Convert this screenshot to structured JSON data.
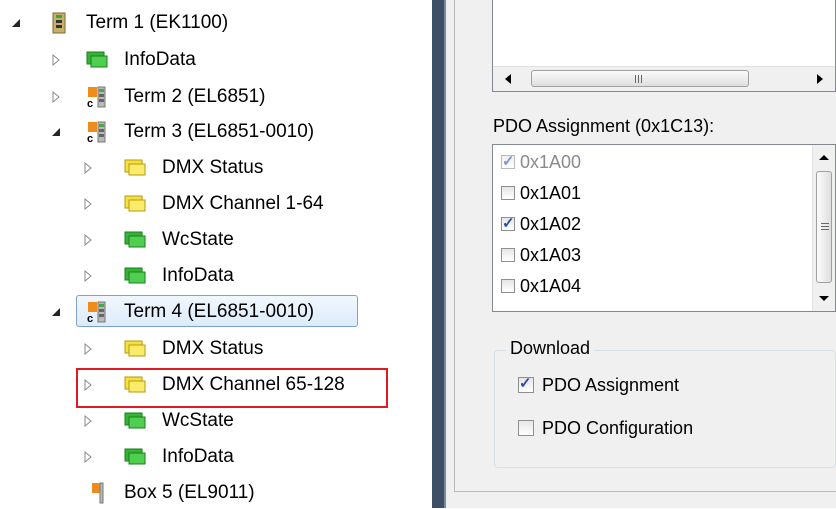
{
  "tree": {
    "nodes": [
      {
        "label": "Term 1 (EK1100)",
        "expand": "expanded",
        "icon": "coupler-icon"
      },
      {
        "label": "InfoData",
        "expand": "collapsed",
        "icon": "green-folder-icon"
      },
      {
        "label": "Term 2 (EL6851)",
        "expand": "collapsed",
        "icon": "terminal-icon"
      },
      {
        "label": "Term 3 (EL6851-0010)",
        "expand": "expanded",
        "icon": "terminal-icon"
      },
      {
        "label": "DMX Status",
        "expand": "collapsed",
        "icon": "yellow-folder-icon"
      },
      {
        "label": "DMX Channel 1-64",
        "expand": "collapsed",
        "icon": "yellow-folder-icon"
      },
      {
        "label": "WcState",
        "expand": "collapsed",
        "icon": "green-folder-icon"
      },
      {
        "label": "InfoData",
        "expand": "collapsed",
        "icon": "green-folder-icon"
      },
      {
        "label": "Term 4 (EL6851-0010)",
        "expand": "expanded",
        "icon": "terminal-icon",
        "selected": true
      },
      {
        "label": "DMX Status",
        "expand": "collapsed",
        "icon": "yellow-folder-icon"
      },
      {
        "label": "DMX Channel 65-128",
        "expand": "collapsed",
        "icon": "yellow-folder-icon",
        "highlighted": true
      },
      {
        "label": "WcState",
        "expand": "collapsed",
        "icon": "green-folder-icon"
      },
      {
        "label": "InfoData",
        "expand": "collapsed",
        "icon": "green-folder-icon"
      },
      {
        "label": "Box 5 (EL9011)",
        "expand": "none",
        "icon": "end-terminal-icon"
      }
    ]
  },
  "pdo_assignment": {
    "title": "PDO Assignment (0x1C13):",
    "items": [
      {
        "label": "0x1A00",
        "checked": true,
        "disabled": true
      },
      {
        "label": "0x1A01",
        "checked": false,
        "disabled": false
      },
      {
        "label": "0x1A02",
        "checked": true,
        "disabled": false
      },
      {
        "label": "0x1A03",
        "checked": false,
        "disabled": false
      },
      {
        "label": "0x1A04",
        "checked": false,
        "disabled": false
      }
    ]
  },
  "download": {
    "title": "Download",
    "pdo_assignment_label": "PDO Assignment",
    "pdo_assignment_checked": true,
    "pdo_configuration_label": "PDO Configuration",
    "pdo_configuration_checked": false
  },
  "colors": {
    "highlight_border": "#e01b24",
    "selection_border": "#7da2ce",
    "green_icon": "#33b533",
    "yellow_icon": "#f5e03c",
    "orange_icon": "#f08c1e"
  }
}
